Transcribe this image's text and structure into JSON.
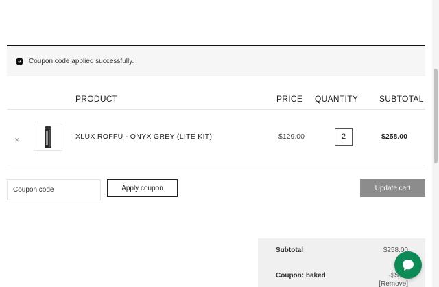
{
  "notice": {
    "message": "Coupon code applied successfully.",
    "icon": "check-circle-icon"
  },
  "table": {
    "headers": {
      "product": "PRODUCT",
      "price": "PRICE",
      "quantity": "QUANTITY",
      "subtotal": "SUBTOTAL"
    },
    "items": [
      {
        "remove": "×",
        "name": "XLUX ROFFU - ONYX GREY (LITE KIT)",
        "price": "$129.00",
        "quantity": "2",
        "subtotal": "$258.00"
      }
    ]
  },
  "actions": {
    "coupon_placeholder": "Coupon code",
    "apply_label": "Apply coupon",
    "update_label": "Update cart"
  },
  "totals": {
    "subtotal_label": "Subtotal",
    "subtotal_value": "$258.00",
    "coupon_label": "Coupon: baked",
    "coupon_value": "-$51.6",
    "remove_label": "[Remove]"
  },
  "colors": {
    "chat_bubble": "#0e8a57",
    "update_button": "#8c8c8c",
    "totals_bg": "#f0f0f0"
  }
}
